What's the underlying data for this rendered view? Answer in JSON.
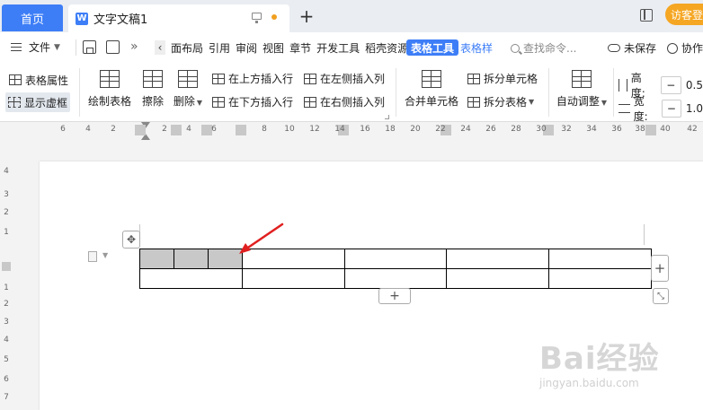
{
  "titlebar": {
    "home_tab": "首页",
    "doc_icon_letter": "W",
    "doc_title": "文字文稿1",
    "add_tab": "+",
    "visitor_login": "访客登"
  },
  "menubar": {
    "file_label": "文件",
    "items": [
      "面布局",
      "引用",
      "审阅",
      "视图",
      "章节",
      "开发工具",
      "稻壳资源"
    ],
    "table_tools": "表格工具",
    "table_style": "表格样",
    "search_placeholder": "查找命令...",
    "unsaved": "未保存",
    "collab": "协作"
  },
  "ribbon": {
    "table_props": "表格属性",
    "show_gridlines": "显示虚框",
    "draw_table": "绘制表格",
    "eraser": "擦除",
    "delete": "删除",
    "insert_above": "在上方插入行",
    "insert_below": "在下方插入行",
    "insert_left": "在左侧插入列",
    "insert_right": "在右侧插入列",
    "merge_cells": "合并单元格",
    "split_cells": "拆分单元格",
    "split_table": "拆分表格",
    "auto_fit": "自动调整",
    "height_label": "高度:",
    "height_value": "0.5",
    "width_label": "宽度:",
    "width_value": "1.0",
    "minus": "−"
  },
  "hruler": {
    "labels": [
      "6",
      "4",
      "2",
      "2",
      "4",
      "6",
      "8",
      "10",
      "12",
      "14",
      "16",
      "18",
      "20",
      "22",
      "24",
      "26",
      "28",
      "30",
      "32",
      "34",
      "36",
      "38",
      "40",
      "42",
      "44"
    ]
  },
  "vruler": {
    "labels": [
      "4",
      "3",
      "2",
      "1",
      "1",
      "2",
      "3",
      "4",
      "5",
      "6",
      "7",
      "8"
    ]
  },
  "page": {
    "move_glyph": "✥",
    "add_glyph": "+",
    "resize_glyph": "⤡"
  },
  "table": {
    "rows": 2,
    "selected_cells": 3
  },
  "watermark": {
    "brand": "Bai经验",
    "url": "jingyan.baidu.com"
  },
  "colors": {
    "accent": "#3d7ef7",
    "visitor": "#f5a623",
    "arrow": "#e02020",
    "selected_cell": "#c8c8c8"
  }
}
